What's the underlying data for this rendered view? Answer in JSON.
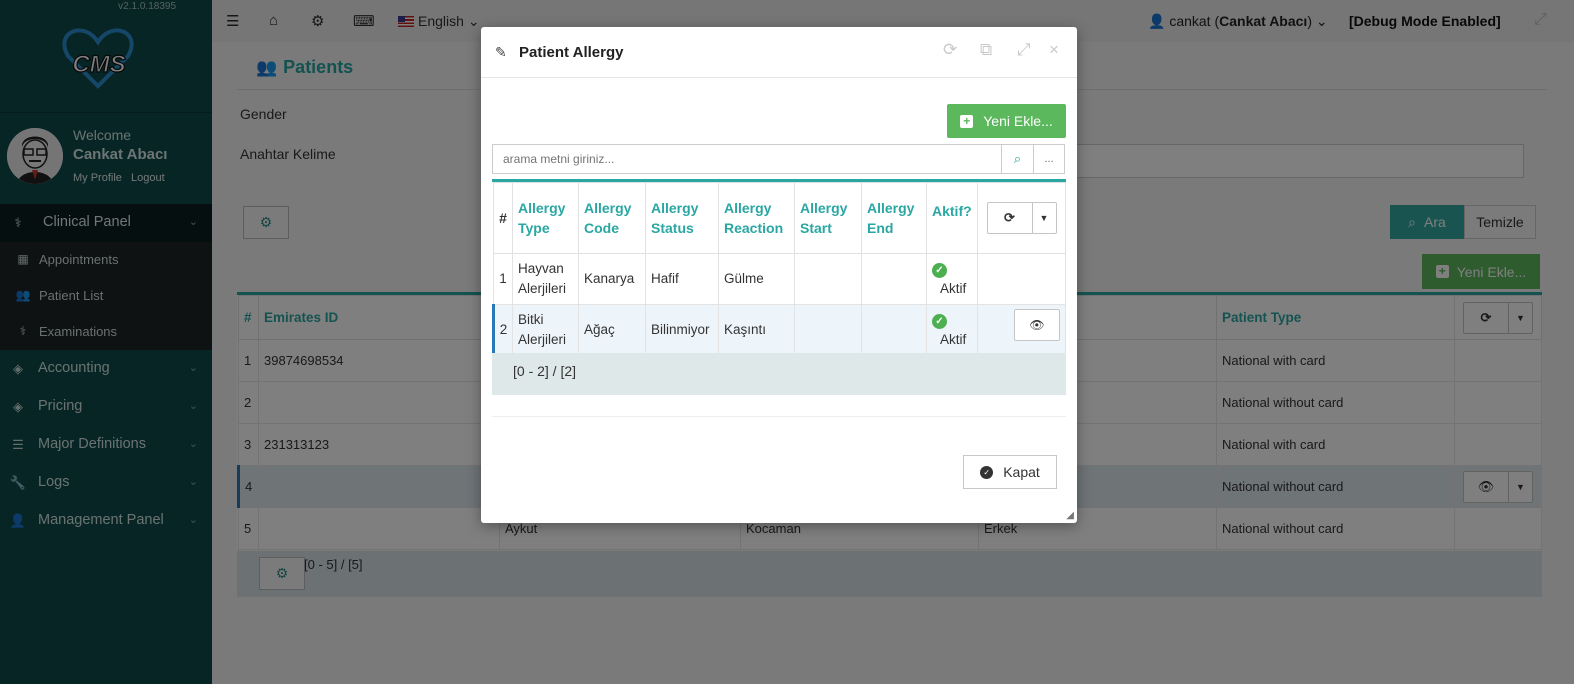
{
  "app": {
    "version": "v2.1.0.18395",
    "logo_text": "CMS"
  },
  "user": {
    "welcome": "Welcome",
    "name": "Cankat Abacı",
    "my_profile": "My Profile",
    "logout": "Logout"
  },
  "sidebar": {
    "items": [
      {
        "label": "Clinical Panel",
        "icon": "stethoscope-icon"
      },
      {
        "label": "Accounting",
        "icon": "tag-icon"
      },
      {
        "label": "Pricing",
        "icon": "tag-icon"
      },
      {
        "label": "Major Definitions",
        "icon": "list-icon"
      },
      {
        "label": "Logs",
        "icon": "wrench-icon"
      },
      {
        "label": "Management Panel",
        "icon": "user-icon"
      }
    ],
    "clinical_sub": [
      {
        "label": "Appointments",
        "icon": "calendar-icon"
      },
      {
        "label": "Patient List",
        "icon": "users-icon"
      },
      {
        "label": "Examinations",
        "icon": "stethoscope-icon"
      }
    ]
  },
  "topbar": {
    "language": "English",
    "user_login": "cankat",
    "user_display": "Cankat Abacı",
    "debug": "[Debug Mode Enabled]"
  },
  "page": {
    "title": "Patients",
    "gender_label": "Gender",
    "keyword_label": "Anahtar Kelime",
    "search_button": "Ara",
    "clear_button": "Temizle",
    "new_button": "Yeni Ekle...",
    "table": {
      "columns": [
        "#",
        "Emirates ID",
        "Patient Type"
      ],
      "rows": [
        {
          "num": "1",
          "emirates_id": "39874698534",
          "name": "",
          "surname": "",
          "gender": "",
          "patient_type": "National with card"
        },
        {
          "num": "2",
          "emirates_id": "",
          "name": "",
          "surname": "",
          "gender": "",
          "patient_type": "National without card"
        },
        {
          "num": "3",
          "emirates_id": "231313123",
          "name": "",
          "surname": "",
          "gender": "",
          "patient_type": "National with card"
        },
        {
          "num": "4",
          "emirates_id": "",
          "name": "",
          "surname": "",
          "gender": "",
          "patient_type": "National without card"
        },
        {
          "num": "5",
          "emirates_id": "",
          "name": "Aykut",
          "surname": "Kocaman",
          "gender": "Erkek",
          "patient_type": "National without card"
        }
      ],
      "pager": "[0 - 5] / [5]"
    }
  },
  "modal": {
    "title": "Patient Allergy",
    "new_button": "Yeni Ekle...",
    "search_placeholder": "arama metni giriniz...",
    "more_label": "...",
    "columns": {
      "num": "#",
      "type": "Allergy Type",
      "code": "Allergy Code",
      "status": "Allergy Status",
      "reaction": "Allergy Reaction",
      "start": "Allergy Start",
      "end": "Allergy End",
      "active": "Aktif?"
    },
    "rows": [
      {
        "num": "1",
        "type": "Hayvan Alerjileri",
        "code": "Kanarya",
        "status": "Hafif",
        "reaction": "Gülme",
        "start": "",
        "end": "",
        "active": "Aktif"
      },
      {
        "num": "2",
        "type": "Bitki Alerjileri",
        "code": "Ağaç",
        "status": "Bilinmiyor",
        "reaction": "Kaşıntı",
        "start": "",
        "end": "",
        "active": "Aktif"
      }
    ],
    "pager": "[0 - 2] / [2]",
    "close_button": "Kapat"
  }
}
